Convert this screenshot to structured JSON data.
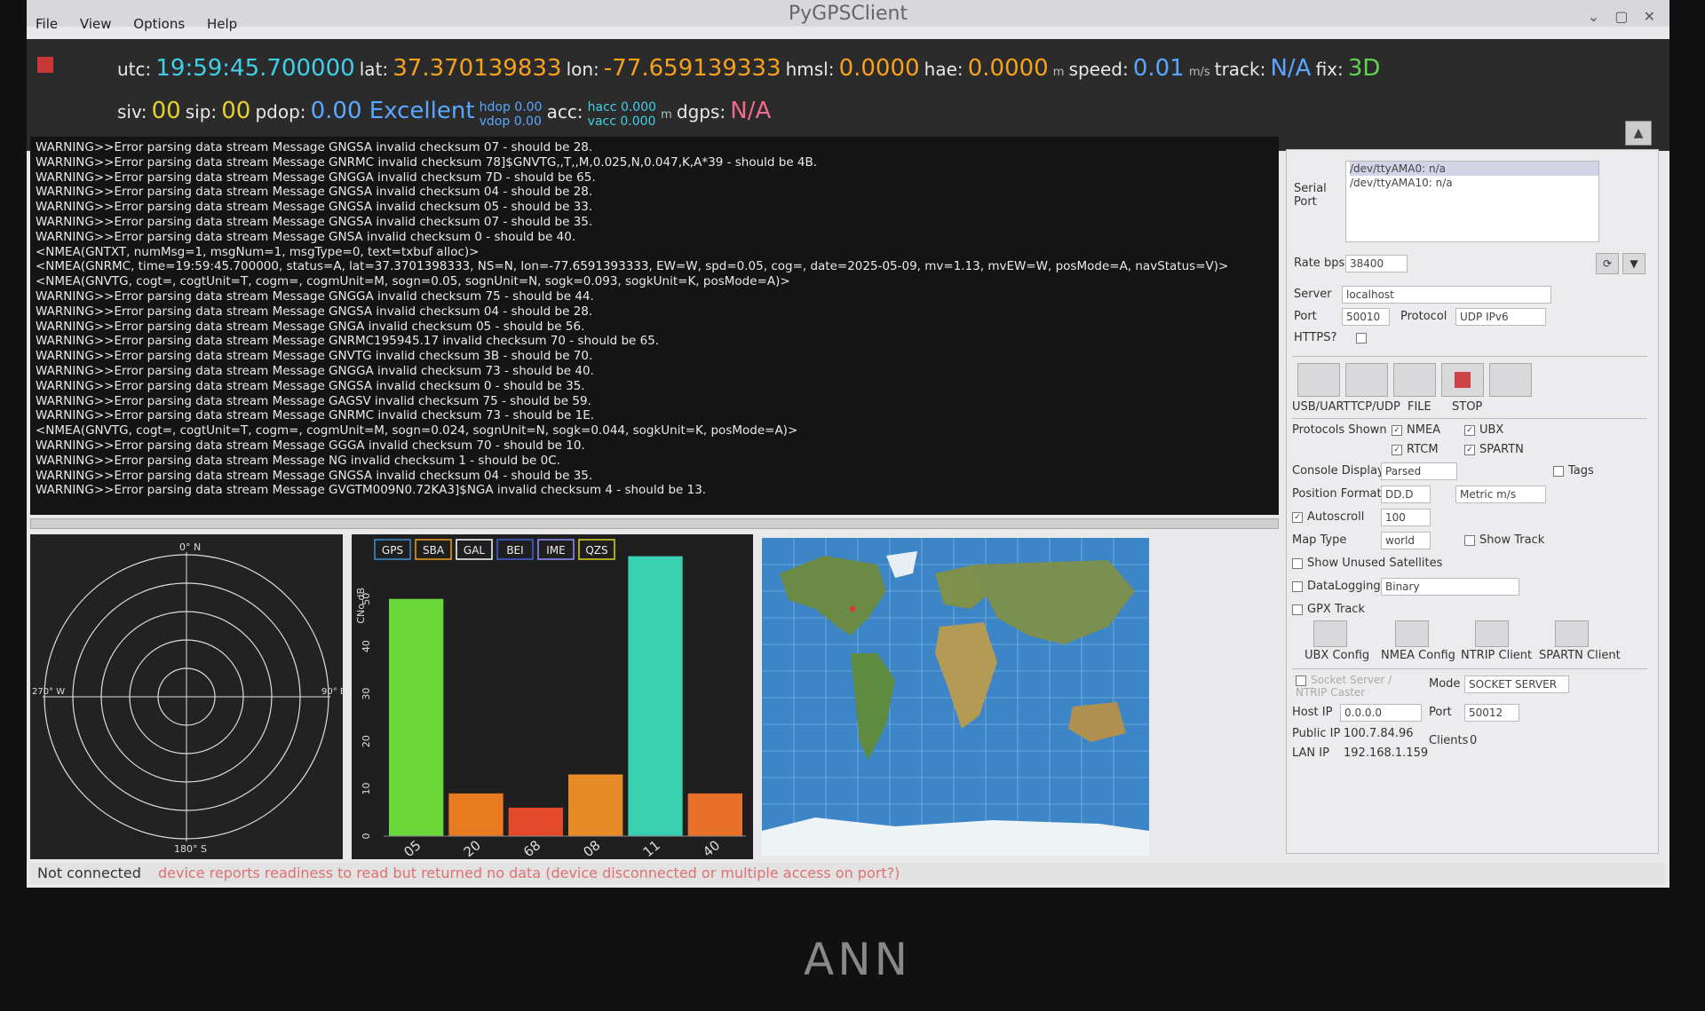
{
  "window": {
    "title": "PyGPSClient"
  },
  "menu": [
    "File",
    "View",
    "Options",
    "Help"
  ],
  "banner": {
    "utc_label": "utc:",
    "utc": "19:59:45.700000",
    "lat_label": "lat:",
    "lat": "37.370139833",
    "lon_label": "lon:",
    "lon": "-77.659139333",
    "hmsl_label": "hmsl:",
    "hmsl": "0.0000",
    "hae_label": "hae:",
    "hae": "0.0000",
    "alt_unit": "m",
    "speed_label": "speed:",
    "speed": "0.01",
    "speed_unit": "m/s",
    "track_label": "track:",
    "track": "N/A",
    "fix_label": "fix:",
    "fix": "3D",
    "siv_label": "siv:",
    "siv": "00",
    "sip_label": "sip:",
    "sip": "00",
    "pdop_label": "pdop:",
    "pdop": "0.00 Excellent",
    "hdop": "hdop 0.00",
    "vdop": "vdop 0.00",
    "acc_label": "acc:",
    "hacc": "hacc 0.000",
    "vacc": "vacc 0.000",
    "acc_unit": "m",
    "dgps_label": "dgps:",
    "dgps": "N/A"
  },
  "console_lines": [
    "WARNING>>Error parsing data stream Message GNGSA invalid checksum 07 - should be 28.",
    "WARNING>>Error parsing data stream Message GNRMC invalid checksum 78]$GNVTG,,T,,M,0.025,N,0.047,K,A*39 - should be 4B.",
    "WARNING>>Error parsing data stream Message GNGGA invalid checksum 7D - should be 65.",
    "WARNING>>Error parsing data stream Message GNGSA invalid checksum 04 - should be 28.",
    "WARNING>>Error parsing data stream Message GNGSA invalid checksum 05 - should be 33.",
    "WARNING>>Error parsing data stream Message GNGSA invalid checksum 07 - should be 35.",
    "WARNING>>Error parsing data stream Message GNSA invalid checksum 0 - should be 40.",
    "<NMEA(GNTXT, numMsg=1, msgNum=1, msgType=0, text=txbuf alloc)>",
    "<NMEA(GNRMC, time=19:59:45.700000, status=A, lat=37.3701398333, NS=N, lon=-77.6591393333, EW=W, spd=0.05, cog=, date=2025-05-09, mv=1.13, mvEW=W, posMode=A, navStatus=V)>",
    "<NMEA(GNVTG, cogt=, cogtUnit=T, cogm=, cogmUnit=M, sogn=0.05, sognUnit=N, sogk=0.093, sogkUnit=K, posMode=A)>",
    "WARNING>>Error parsing data stream Message GNGGA invalid checksum 75 - should be 44.",
    "WARNING>>Error parsing data stream Message GNGSA invalid checksum 04 - should be 28.",
    "WARNING>>Error parsing data stream Message GNGA invalid checksum 05 - should be 56.",
    "WARNING>>Error parsing data stream Message GNRMC195945.17 invalid checksum 70 - should be 65.",
    "WARNING>>Error parsing data stream Message GNVTG invalid checksum 3B - should be 70.",
    "WARNING>>Error parsing data stream Message GNGGA invalid checksum 73 - should be 40.",
    "WARNING>>Error parsing data stream Message GNGSA invalid checksum 0 - should be 35.",
    "WARNING>>Error parsing data stream Message GAGSV invalid checksum 75 - should be 59.",
    "WARNING>>Error parsing data stream Message GNRMC invalid checksum 73 - should be 1E.",
    "<NMEA(GNVTG, cogt=, cogtUnit=T, cogm=, cogmUnit=M, sogn=0.024, sognUnit=N, sogk=0.044, sogkUnit=K, posMode=A)>",
    "WARNING>>Error parsing data stream Message GGGA invalid checksum 70 - should be 10.",
    "WARNING>>Error parsing data stream Message NG invalid checksum 1 - should be 0C.",
    "WARNING>>Error parsing data stream Message GNGSA invalid checksum 04 - should be 35.",
    "WARNING>>Error parsing data stream Message GVGTM009N0.72KA3]$NGA invalid checksum 4 - should be 13."
  ],
  "skyview": {
    "n": "0° N",
    "e": "90° E",
    "s": "180° S",
    "w": "270° W"
  },
  "levels": {
    "constellations": [
      {
        "label": "GPS",
        "color": "#3e8ed0"
      },
      {
        "label": "SBA",
        "color": "#f0a020"
      },
      {
        "label": "GAL",
        "color": "#ffffff"
      },
      {
        "label": "BEI",
        "color": "#4060e0"
      },
      {
        "label": "IME",
        "color": "#9090ff"
      },
      {
        "label": "QZS",
        "color": "#e0d020"
      }
    ],
    "ylabel": "CNo dB",
    "yticks": [
      "0",
      "10",
      "20",
      "30",
      "40",
      "50"
    ]
  },
  "chart_data": {
    "type": "bar",
    "categories": [
      "05",
      "20",
      "68",
      "08",
      "11",
      "40"
    ],
    "values": [
      50,
      9,
      6,
      13,
      60,
      9
    ],
    "ylabel": "CNo dB",
    "ylim": [
      0,
      55
    ]
  },
  "settings": {
    "serial_port_label": "Serial Port",
    "ports": [
      "/dev/ttyAMA0: n/a",
      "/dev/ttyAMA10: n/a"
    ],
    "rate_label": "Rate bps",
    "rate": "38400",
    "server_label": "Server",
    "server": "localhost",
    "port_label": "Port",
    "port": "50010",
    "protocol_label": "Protocol",
    "protocol": "UDP IPv6",
    "https_label": "HTTPS?",
    "tools": [
      "USB/UART",
      "TCP/UDP",
      "FILE",
      "STOP"
    ],
    "protocols_label": "Protocols Shown",
    "nmea": "NMEA",
    "ubx": "UBX",
    "rtcm": "RTCM",
    "spartn": "SPARTN",
    "console_display_label": "Console Display",
    "console_display": "Parsed",
    "tags": "Tags",
    "position_format_label": "Position Format",
    "position_format": "DD.D",
    "units": "Metric m/s",
    "autoscroll": "Autoscroll",
    "autoscroll_value": "100",
    "map_type_label": "Map Type",
    "map_type": "world",
    "show_track": "Show Track",
    "show_unused": "Show Unused Satellites",
    "datalogging": "DataLogging",
    "datalogging_value": "Binary",
    "gpx_track": "GPX Track",
    "config_buttons": [
      "UBX Config",
      "NMEA Config",
      "NTRIP Client",
      "SPARTN Client"
    ],
    "socket_server": "Socket Server / NTRIP Caster",
    "mode_label": "Mode",
    "mode": "SOCKET SERVER",
    "host_ip_label": "Host IP",
    "host_ip": "0.0.0.0",
    "sport_label": "Port",
    "sport": "50012",
    "public_ip_label": "Public IP",
    "public_ip": "100.7.84.96",
    "clients_label": "Clients",
    "clients": "0",
    "lan_ip_label": "LAN IP",
    "lan_ip": "192.168.1.159"
  },
  "status": {
    "state": "Not connected",
    "message": "device reports readiness to read but returned no data (device disconnected or multiple access on port?)"
  },
  "bezel_logo": "ANN"
}
